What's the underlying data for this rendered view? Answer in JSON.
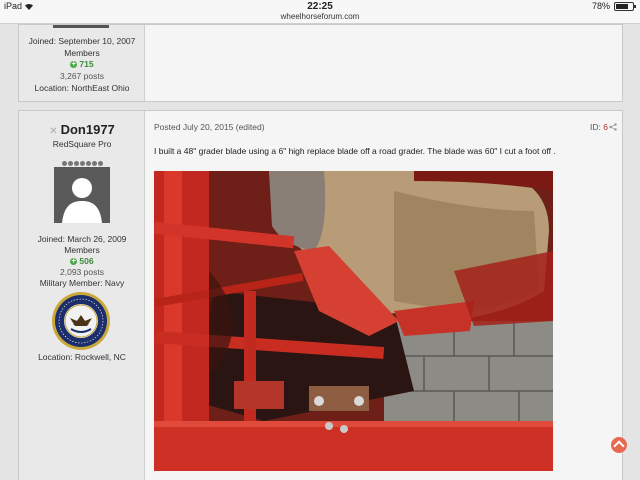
{
  "status_bar": {
    "device": "iPad",
    "time": "22:25",
    "url": "wheelhorseforum.com",
    "battery": "78%",
    "battery_level": 0.78
  },
  "post_prev": {
    "joined": "Joined: September 10, 2007",
    "group": "Members",
    "reputation": "715",
    "posts": "3,267 posts",
    "location": "Location: NorthEast Ohio"
  },
  "post": {
    "username": "Don1977",
    "rank": "RedSquare Pro",
    "rank_pips": 7,
    "joined": "Joined: March 26, 2009",
    "group": "Members",
    "reputation": "506",
    "posts": "2,093 posts",
    "military": "Military Member: Navy",
    "location": "Location: Rockwell, NC",
    "posted": "Posted July 20, 2015 (edited)",
    "id_label": "ID:",
    "id_value": "6",
    "text": "I built a 48\" grader blade using a 6\" high replace blade off a road grader.  The blade was 60\" I cut a foot off ."
  },
  "colors": {
    "accent_red": "#b03030",
    "reputation_green": "#4aa64a",
    "scroll_top": "#e56a50"
  },
  "icons": [
    "wifi-icon",
    "battery-icon",
    "offline-icon",
    "reputation-icon",
    "share-icon",
    "navy-seal-icon",
    "scroll-top-icon",
    "default-avatar-icon"
  ]
}
